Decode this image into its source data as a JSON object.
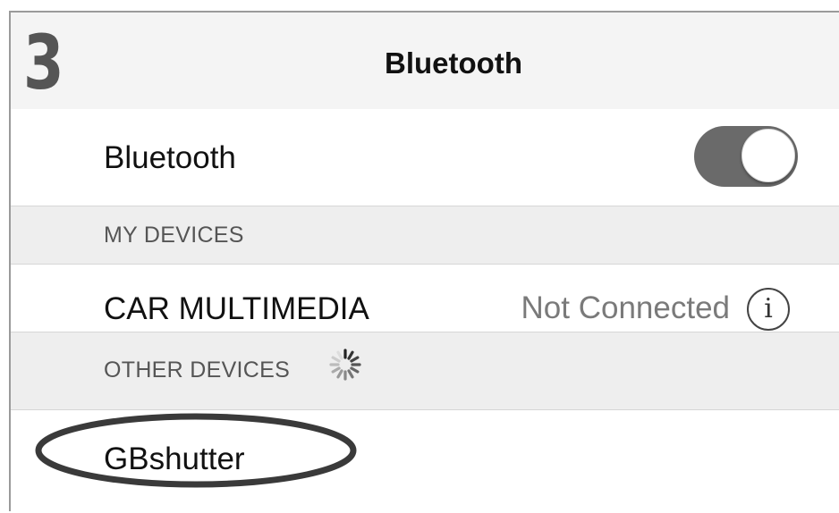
{
  "header": {
    "step_number": "3",
    "title": "Bluetooth"
  },
  "bluetooth_row": {
    "label": "Bluetooth",
    "enabled": true
  },
  "my_devices": {
    "section_label": "MY DEVICES",
    "devices": [
      {
        "name": "CAR MULTIMEDIA",
        "status": "Not Connected",
        "info_icon": "info-icon"
      }
    ]
  },
  "other_devices": {
    "section_label": "OTHER DEVICES",
    "spinner_icon": "loading-spinner-icon",
    "devices": [
      {
        "name": "GBshutter"
      }
    ]
  },
  "colors": {
    "toggle_on": "#6a6a6a",
    "section_background": "#eeeeee",
    "highlight_ellipse": "#3a3a3a"
  }
}
